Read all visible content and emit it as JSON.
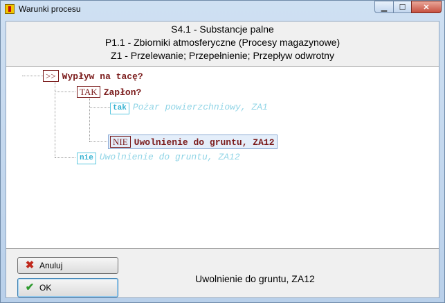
{
  "window": {
    "title": "Warunki procesu"
  },
  "header": {
    "line1": "S4.1 - Substancje palne",
    "line2": "P1.1 - Zbiorniki atmosferyczne (Procesy magazynowe)",
    "line3": "Z1 - Przelewanie; Przepełnienie; Przepływ odwrotny"
  },
  "tree": {
    "root": {
      "tag": ">>",
      "label": "Wypływ na tacę?"
    },
    "child": {
      "tag": "TAK",
      "label": "Zapłon?"
    },
    "grand_yes": {
      "tag": "tak",
      "label": "Pożar powierzchniowy, ZA1"
    },
    "grand_no": {
      "tag": "NIE",
      "label": "Uwolnienie do gruntu, ZA12"
    },
    "root_no": {
      "tag": "nie",
      "label": "Uwolnienie do gruntu, ZA12"
    }
  },
  "buttons": {
    "cancel": "Anuluj",
    "ok": "OK"
  },
  "status": "Uwolnienie do gruntu, ZA12"
}
